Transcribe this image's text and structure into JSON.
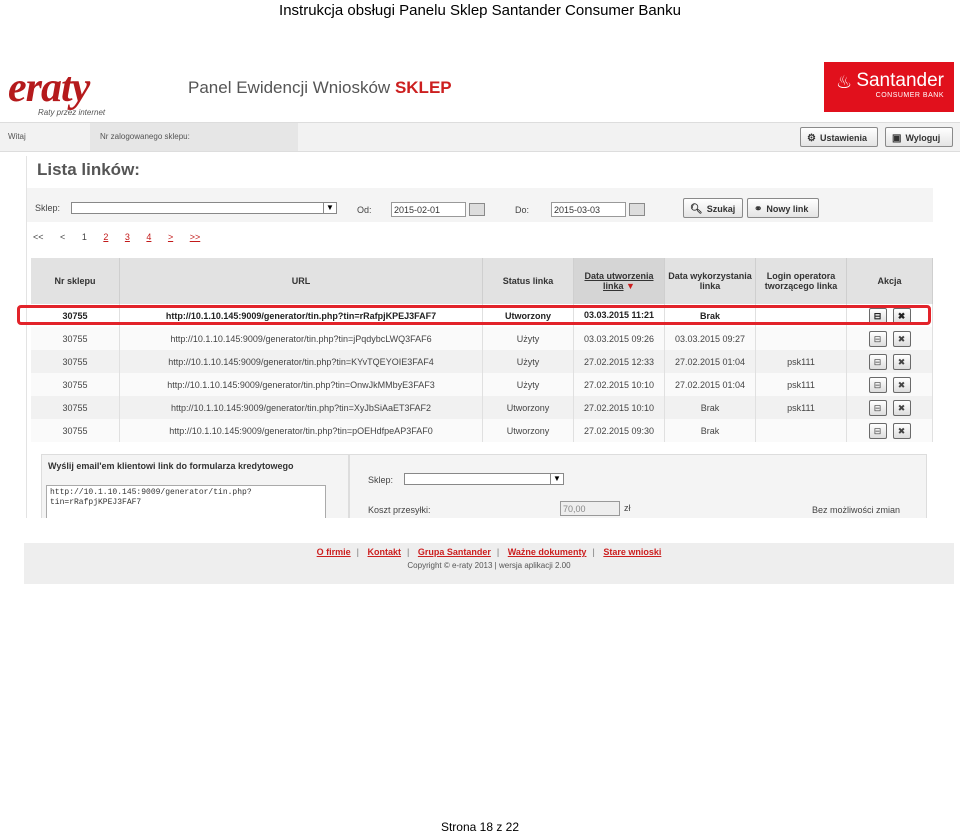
{
  "document": {
    "header": "Instrukcja obsługi Panelu Sklep Santander Consumer Banku",
    "page_footer": "Strona 18 z 22"
  },
  "brand": {
    "logo_text": "eraty",
    "tagline": "Raty przez internet",
    "panel_title": "Panel Ewidencji Wniosków",
    "panel_title_accent": "SKLEP",
    "bank_name": "Santander",
    "bank_sub": "CONSUMER BANK",
    "accent_color": "#cc1f1f",
    "bank_color": "#e1101c"
  },
  "topbar": {
    "welcome": "Witaj",
    "shop_label": "Nr zalogowanego sklepu:",
    "settings_label": "Ustawienia",
    "logout_label": "Wyloguj"
  },
  "page": {
    "title": "Lista linków:",
    "filters": {
      "shop_label": "Sklep:",
      "from_label": "Od:",
      "from_value": "2015-02-01",
      "to_label": "Do:",
      "to_value": "2015-03-03",
      "search_label": "Szukaj",
      "new_link_label": "Nowy link"
    },
    "pagination": [
      "<<",
      "<",
      "1",
      "2",
      "3",
      "4",
      ">",
      ">>"
    ],
    "table": {
      "headers": [
        "Nr sklepu",
        "URL",
        "Status linka",
        "Data utworzenia linka",
        "Data wykorzystania linka",
        "Login operatora tworzącego linka",
        "Akcja"
      ],
      "rows": [
        [
          "30755",
          "http://10.1.10.145:9009/generator/tin.php?tin=rRafpjKPEJ3FAF7",
          "Utworzony",
          "03.03.2015 11:21",
          "Brak",
          ""
        ],
        [
          "30755",
          "http://10.1.10.145:9009/generator/tin.php?tin=jPqdybcLWQ3FAF6",
          "Użyty",
          "03.03.2015 09:26",
          "03.03.2015 09:27",
          ""
        ],
        [
          "30755",
          "http://10.1.10.145:9009/generator/tin.php?tin=KYvTQEYOIE3FAF4",
          "Użyty",
          "27.02.2015 12:33",
          "27.02.2015 01:04",
          "psk111"
        ],
        [
          "30755",
          "http://10.1.10.145:9009/generator/tin.php?tin=OnwJkMMbyE3FAF3",
          "Użyty",
          "27.02.2015 10:10",
          "27.02.2015 01:04",
          "psk111"
        ],
        [
          "30755",
          "http://10.1.10.145:9009/generator/tin.php?tin=XyJbSiAaET3FAF2",
          "Utworzony",
          "27.02.2015 10:10",
          "Brak",
          "psk111"
        ],
        [
          "30755",
          "http://10.1.10.145:9009/generator/tin.php?tin=pOEHdfpeAP3FAF0",
          "Utworzony",
          "27.02.2015 09:30",
          "Brak",
          ""
        ]
      ]
    },
    "email_box": {
      "title": "Wyślij email'em klientowi link do formularza kredytowego",
      "textarea_line1": "http://10.1.10.145:9009/generator/tin.php?",
      "textarea_line2": "tin=rRafpjKPEJ3FAF7"
    },
    "right_box": {
      "shop_label": "Sklep:",
      "shipping_label": "Koszt przesyłki:",
      "shipping_value": "70,00",
      "currency": "zł",
      "no_changes": "Bez możliwości zmian"
    }
  },
  "site_footer": {
    "links": [
      "O firmie",
      "Kontakt",
      "Grupa Santander",
      "Ważne dokumenty",
      "Stare wnioski"
    ],
    "copyright": "Copyright © e-raty 2013 | wersja aplikacji 2.00"
  }
}
